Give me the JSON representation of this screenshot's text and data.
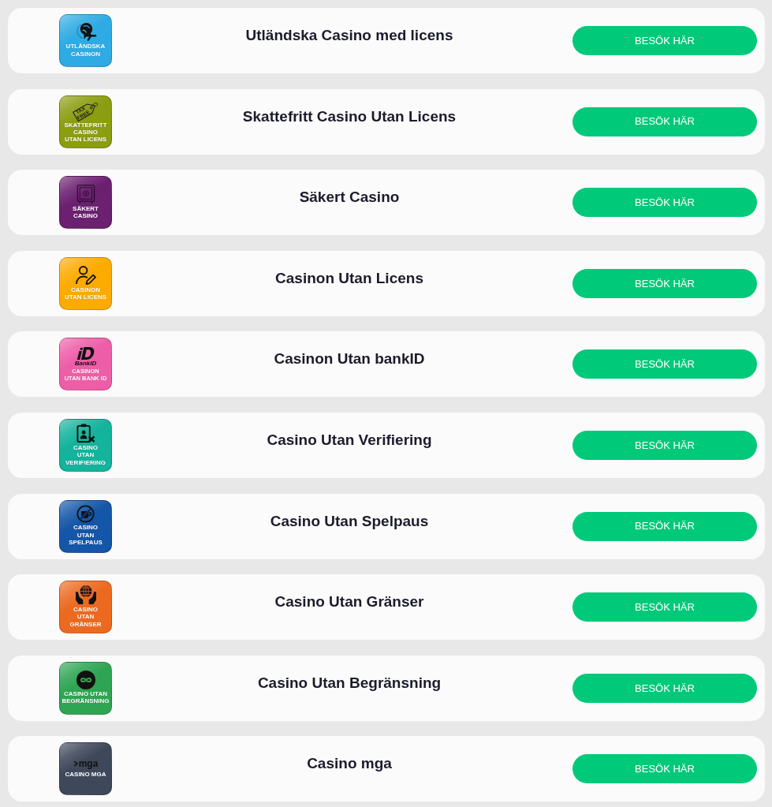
{
  "casinos": [
    {
      "logo": {
        "kind": "travel",
        "color": "#2eabe4",
        "label": "UTLÄNDSKA\nCASINON"
      },
      "title": "Utländska Casino med licens",
      "button": "BESÖK HÄR"
    },
    {
      "logo": {
        "kind": "taxfree",
        "color": "#8b9d10",
        "label": "SKATTEFRITT\nCASINO\nUTAN LICENS",
        "mark_text": "TAX\nFREE"
      },
      "title": "Skattefritt Casino Utan Licens",
      "button": "BESÖK HÄR"
    },
    {
      "logo": {
        "kind": "safe",
        "color": "#6b2070",
        "label": "SÄKERT\nCASINO"
      },
      "title": "Säkert Casino",
      "button": "BESÖK HÄR"
    },
    {
      "logo": {
        "kind": "license",
        "color": "#fdab00",
        "label": "CASINON\nUTAN LICENS"
      },
      "title": "Casinon Utan Licens",
      "button": "BESÖK HÄR"
    },
    {
      "logo": {
        "kind": "bankid",
        "color": "#ee5ea8",
        "label": "CASINON\nUTAN BANK ID",
        "mark_text": "BankID"
      },
      "title": "Casinon Utan bankID",
      "button": "BESÖK HÄR"
    },
    {
      "logo": {
        "kind": "verification",
        "color": "#13b39c",
        "label": "CASINO\nUTAN\nVERIFIERING"
      },
      "title": "Casino Utan Verifiering",
      "button": "BESÖK HÄR"
    },
    {
      "logo": {
        "kind": "pause",
        "color": "#1456a8",
        "label": "CASINO\nUTAN\nSPELPAUS"
      },
      "title": "Casino Utan Spelpaus",
      "button": "BESÖK HÄR"
    },
    {
      "logo": {
        "kind": "borders",
        "color": "#ec6a20",
        "label": "CASINO\nUTAN\nGRÄNSER"
      },
      "title": "Casino Utan Gränser",
      "button": "BESÖK HÄR"
    },
    {
      "logo": {
        "kind": "infinity",
        "color": "#2ea553",
        "label": "CASINO UTAN\nBEGRÄNSNING"
      },
      "title": "Casino Utan Begränsning",
      "button": "BESÖK HÄR"
    },
    {
      "logo": {
        "kind": "mga",
        "color": "#3f485b",
        "label": "CASINO MGA",
        "mark_text": "mga"
      },
      "title": "Casino mga",
      "button": "BESÖK HÄR"
    }
  ]
}
